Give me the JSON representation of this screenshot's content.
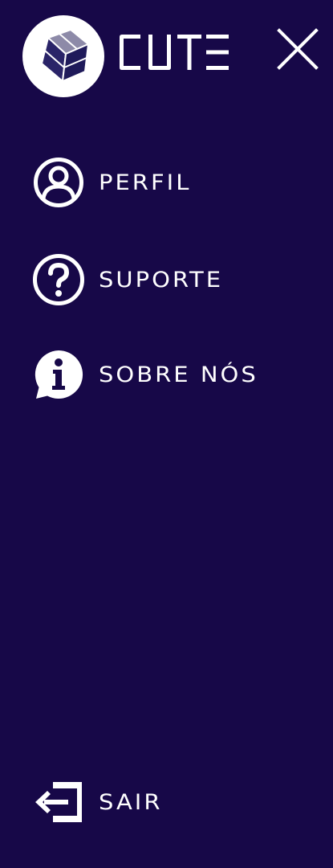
{
  "header": {
    "brand": "CUTE",
    "logo_icon": "cube-icon",
    "close_icon": "close-icon"
  },
  "menu": {
    "items": [
      {
        "label": "PERFIL",
        "icon": "user-circle-icon"
      },
      {
        "label": "SUPORTE",
        "icon": "question-circle-icon"
      },
      {
        "label": "SOBRE NÓS",
        "icon": "info-bubble-icon"
      }
    ]
  },
  "footer": {
    "logout_label": "SAIR",
    "logout_icon": "logout-icon"
  },
  "colors": {
    "background": "#170848",
    "foreground": "#ffffff",
    "cube_dark": "#1f1a5a",
    "cube_light": "#8d8aa8"
  }
}
